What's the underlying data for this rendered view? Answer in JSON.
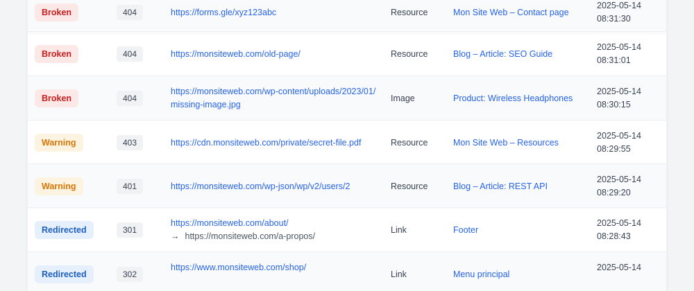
{
  "rows": [
    {
      "status": "Broken",
      "code": "404",
      "url_line1": "https://forms.gle/xyz123abc",
      "type": "Resource",
      "source": "Mon Site Web – Contact page",
      "date": "2025-05-14",
      "time": "08:31:30"
    },
    {
      "status": "Broken",
      "code": "404",
      "url_line1": "https://monsiteweb.com/old-page/",
      "type": "Resource",
      "source": "Blog – Article: SEO Guide",
      "date": "2025-05-14",
      "time": "08:31:01"
    },
    {
      "status": "Broken",
      "code": "404",
      "url_line1": "https://monsiteweb.com/wp-content/uploads/2023/01/",
      "url_line2": "missing-image.jpg",
      "type": "Image",
      "source": "Product: Wireless Headphones",
      "date": "2025-05-14",
      "time": "08:30:15"
    },
    {
      "status": "Warning",
      "code": "403",
      "url_line1": "https://cdn.monsiteweb.com/private/secret-file.pdf",
      "type": "Resource",
      "source": "Mon Site Web – Resources",
      "date": "2025-05-14",
      "time": "08:29:55"
    },
    {
      "status": "Warning",
      "code": "401",
      "url_line1": "https://monsiteweb.com/wp-json/wp/v2/users/2",
      "type": "Resource",
      "source": "Blog – Article: REST API",
      "date": "2025-05-14",
      "time": "08:29:20"
    },
    {
      "status": "Redirected",
      "code": "301",
      "url_line1": "https://monsiteweb.com/about/",
      "redirect_arrow": "→",
      "redirect_target": "https://monsiteweb.com/a-propos/",
      "type": "Link",
      "source": "Footer",
      "date": "2025-05-14",
      "time": "08:28:43"
    },
    {
      "status": "Redirected",
      "code": "302",
      "url_line1": "https://www.monsiteweb.com/shop/",
      "type": "Link",
      "source": "Menu principal",
      "date": "2025-05-14"
    }
  ],
  "colors": {
    "broken_bg": "#fde8e8",
    "broken_text": "#c81e1e",
    "warning_bg": "#fdf3e1",
    "warning_text": "#d97706",
    "redirected_bg": "#e6f0fd",
    "redirected_text": "#1d5fbf",
    "link": "#2563eb"
  },
  "icons": {
    "redirect": "arrow-right-icon"
  }
}
